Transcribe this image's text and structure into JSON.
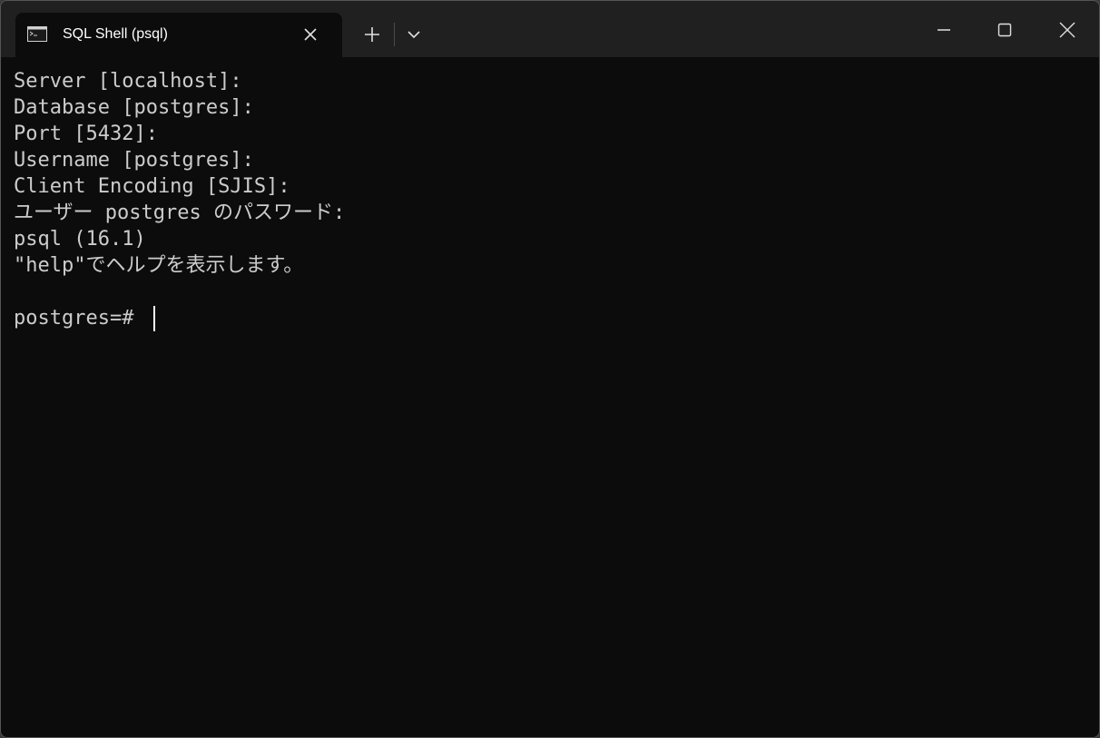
{
  "tab": {
    "title": "SQL Shell (psql)",
    "icon": "terminal-icon"
  },
  "window_controls": {
    "new_tab_icon": "plus-icon",
    "dropdown_icon": "chevron-down-icon",
    "minimize_icon": "minimize-icon",
    "maximize_icon": "maximize-icon",
    "close_icon": "close-icon"
  },
  "terminal": {
    "lines": [
      "Server [localhost]:",
      "Database [postgres]:",
      "Port [5432]:",
      "Username [postgres]:",
      "Client Encoding [SJIS]:",
      "ユーザー postgres のパスワード:",
      "psql (16.1)",
      "\"help\"でヘルプを表示します。",
      "",
      "postgres=#"
    ],
    "prompt": "postgres=#"
  },
  "colors": {
    "background": "#0c0c0c",
    "titlebar": "#202020",
    "text": "#cccccc"
  }
}
